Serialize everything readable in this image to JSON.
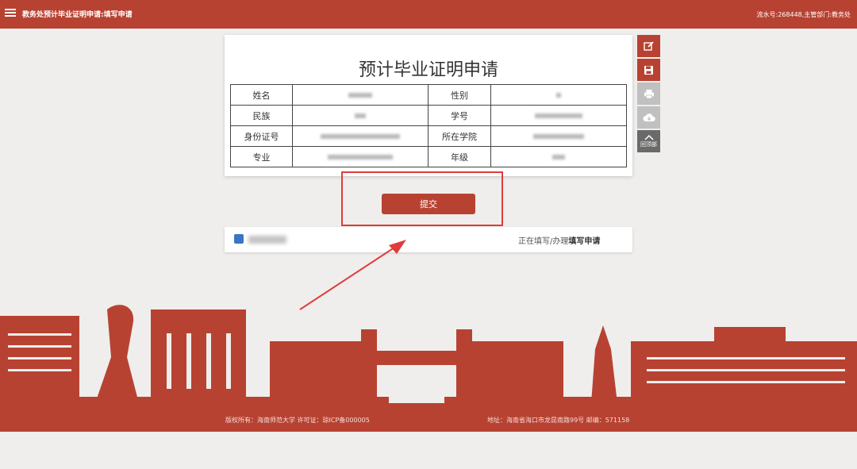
{
  "header": {
    "title": "教务处预计毕业证明申请:填写申请",
    "right_text": "流水号:268448,主管部门:教务处"
  },
  "form": {
    "title": "预计毕业证明申请",
    "rows": [
      {
        "label_left": "姓名",
        "label_right": "性别"
      },
      {
        "label_left": "民族",
        "label_right": "学号"
      },
      {
        "label_left": "身份证号",
        "label_right": "所在学院"
      },
      {
        "label_left": "专业",
        "label_right": "年级"
      }
    ]
  },
  "toolbar": {
    "back_top_label": "回顶部",
    "icons": [
      "edit-icon",
      "save-icon",
      "print-icon",
      "cloud-download-icon",
      "chevron-up-icon"
    ]
  },
  "submit_label": "提交",
  "status": {
    "prefix": "正在填写/办理",
    "bold": "填写申请"
  },
  "footer": {
    "left": "版权所有：海南师范大学 许可证：琼ICP备000005",
    "right": "地址：海南省海口市龙昆南路99号 邮编：571158"
  },
  "colors": {
    "brand": "#b84232",
    "highlight": "#e03c3c"
  }
}
